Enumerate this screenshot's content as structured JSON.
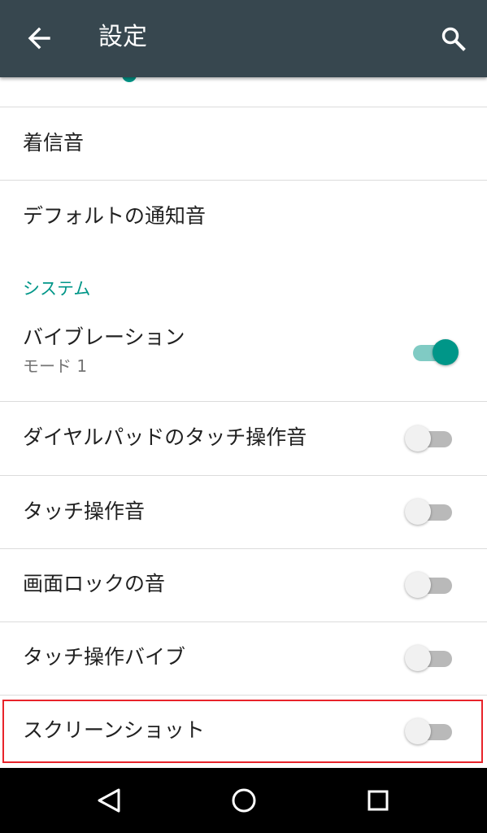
{
  "appbar": {
    "title": "設定",
    "back_icon": "arrow-back-icon",
    "search_icon": "search-icon"
  },
  "colors": {
    "appbar": "#37474f",
    "accent": "#009688",
    "highlight": "#e8232a"
  },
  "items": {
    "ringtone": {
      "label": "着信音"
    },
    "default_notification": {
      "label": "デフォルトの通知音"
    }
  },
  "section_system": "システム",
  "toggles": {
    "vibration": {
      "label": "バイブレーション",
      "sub": "モード 1",
      "on": true
    },
    "dialpad": {
      "label": "ダイヤルパッドのタッチ操作音",
      "on": false
    },
    "touch_sound": {
      "label": "タッチ操作音",
      "on": false
    },
    "lock_sound": {
      "label": "画面ロックの音",
      "on": false
    },
    "touch_vibe": {
      "label": "タッチ操作バイブ",
      "on": false
    },
    "screenshot": {
      "label": "スクリーンショット",
      "on": false
    }
  },
  "navbar": {
    "back": "triangle-back-icon",
    "home": "circle-home-icon",
    "recents": "square-recents-icon"
  }
}
